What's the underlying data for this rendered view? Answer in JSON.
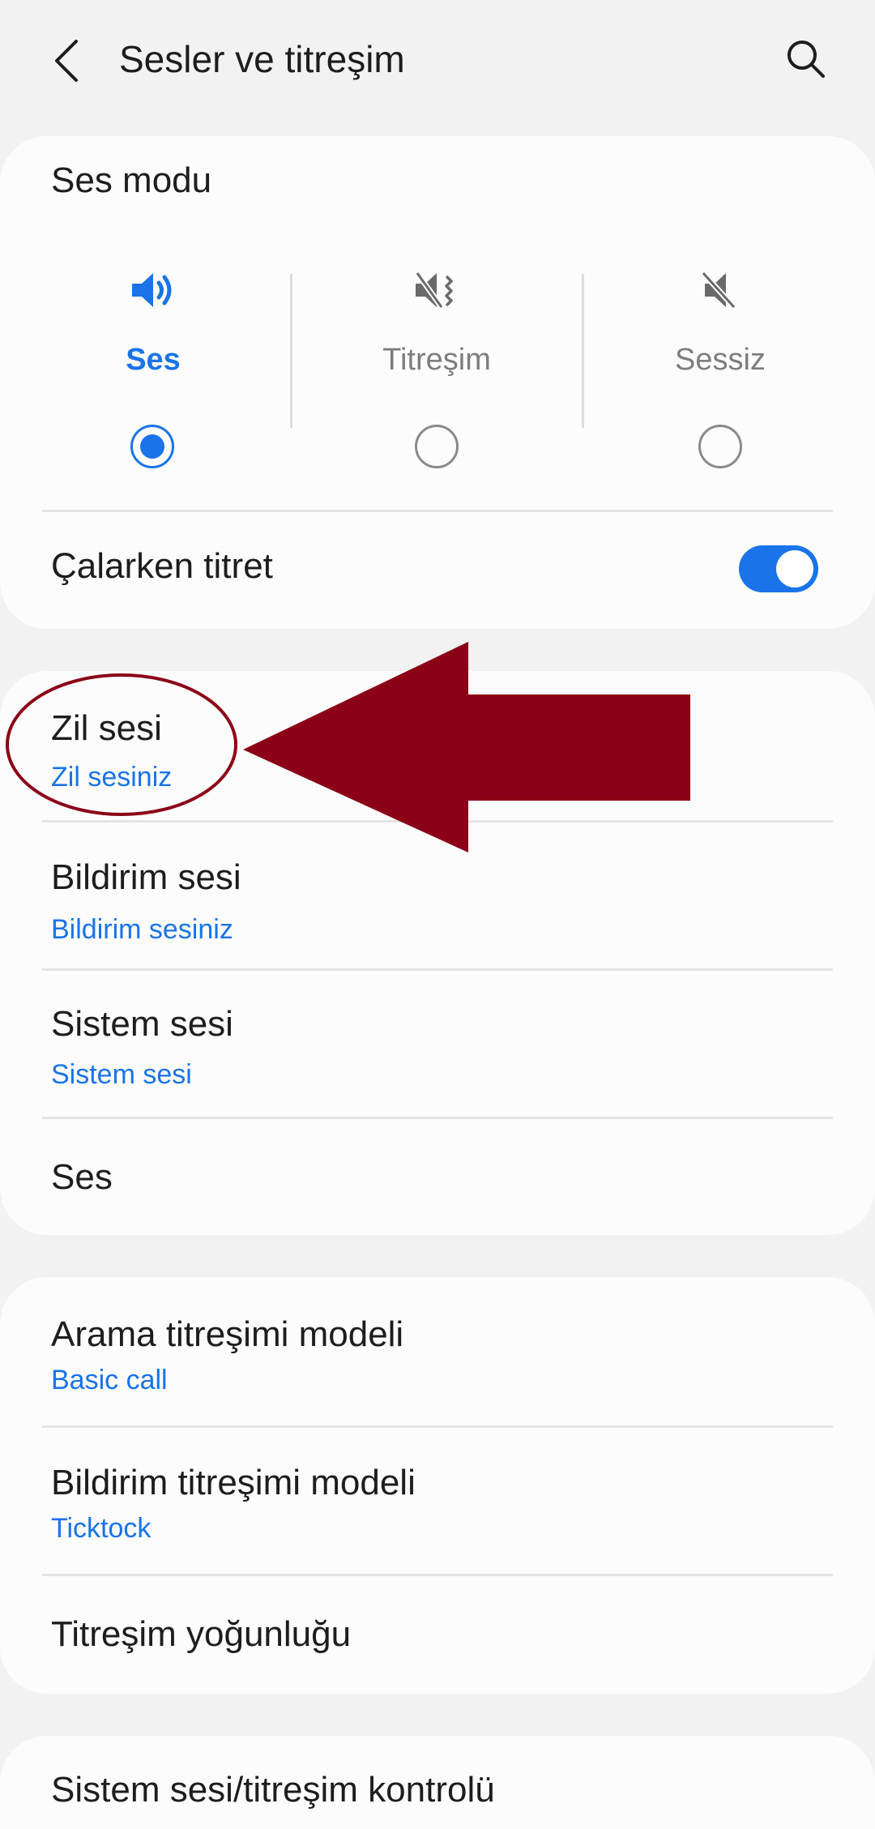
{
  "header": {
    "title": "Sesler ve titreşim",
    "back_icon": "chevron-left-icon",
    "search_icon": "search-icon"
  },
  "sound_mode": {
    "title": "Ses modu",
    "options": [
      {
        "label": "Ses",
        "icon": "volume-icon",
        "selected": true
      },
      {
        "label": "Titreşim",
        "icon": "vibrate-icon",
        "selected": false
      },
      {
        "label": "Sessiz",
        "icon": "mute-icon",
        "selected": false
      }
    ]
  },
  "vibrate_while_ringing": {
    "label": "Çalarken titret",
    "enabled": true
  },
  "sounds": {
    "ringtone": {
      "title": "Zil sesi",
      "value": "Zil sesiniz"
    },
    "notification": {
      "title": "Bildirim sesi",
      "value": "Bildirim sesiniz"
    },
    "system": {
      "title": "Sistem sesi",
      "value": "Sistem sesi"
    },
    "volume": {
      "title": "Ses"
    }
  },
  "vibration": {
    "call_pattern": {
      "title": "Arama titreşimi modeli",
      "value": "Basic call"
    },
    "notification_pattern": {
      "title": "Bildirim titreşimi modeli",
      "value": "Ticktock"
    },
    "intensity": {
      "title": "Titreşim yoğunluğu"
    }
  },
  "system_control": {
    "title": "Sistem sesi/titreşim kontrolü"
  },
  "colors": {
    "accent": "#1a73e8",
    "background": "#f2f2f2",
    "card": "#fcfcfc",
    "annotation": "#8b0016"
  }
}
